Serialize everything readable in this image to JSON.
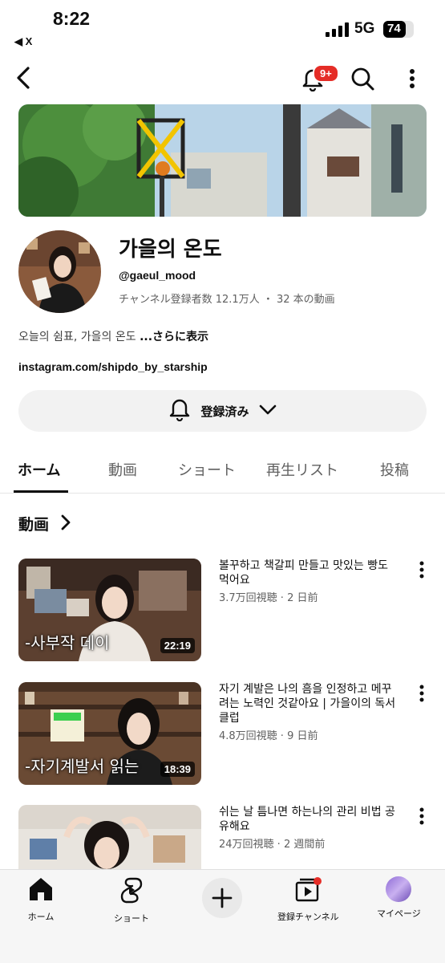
{
  "status_bar": {
    "time": "8:22",
    "back_app": "◀ X",
    "network": "5G",
    "battery": "74",
    "battery_level": 0.74
  },
  "top_bar": {
    "notification_badge": "9+"
  },
  "channel": {
    "name": "가을의 온도",
    "handle": "@gaeul_mood",
    "stats": "チャンネル登録者数 12.1万人 ・ 32 本の動画",
    "description": "오늘의 쉼표, 가을의 온도",
    "description_more": "...さらに表示",
    "link": "instagram.com/shipdo_by_starship"
  },
  "subscribe_button": {
    "label": "登録済み"
  },
  "tabs": [
    {
      "label": "ホーム",
      "active": true
    },
    {
      "label": "動画"
    },
    {
      "label": "ショート"
    },
    {
      "label": "再生リスト"
    },
    {
      "label": "投稿"
    }
  ],
  "section": {
    "title": "動画"
  },
  "videos": [
    {
      "title": "볼꾸하고 책갈피 만들고 맛있는 빵도 먹어요",
      "meta": "3.7万回視聴 · 2 日前",
      "duration": "22:19",
      "overlay": "-사부작 데이"
    },
    {
      "title": "자기 계발은 나의 흠을 인정하고 메꾸려는 노력인 것같아요 | 가을이의 독서클럽",
      "meta": "4.8万回視聴 · 9 日前",
      "duration": "18:39",
      "overlay": "-자기계발서 읽는"
    },
    {
      "title": "쉬는 날 틈나면 하는나의 관리 비법 공유해요",
      "meta": "24万回視聴 · 2 週間前"
    }
  ],
  "bottom_nav": [
    {
      "label": "ホーム",
      "icon": "home-icon"
    },
    {
      "label": "ショート",
      "icon": "shorts-icon"
    },
    {
      "label": "",
      "icon": "create-icon"
    },
    {
      "label": "登録チャンネル",
      "icon": "subscriptions-icon"
    },
    {
      "label": "マイページ",
      "icon": "avatar"
    }
  ],
  "colors": {
    "accent_red": "#e52d27",
    "text_primary": "#0f0f0f",
    "text_secondary": "#606060",
    "button_bg": "#f2f2f2"
  }
}
